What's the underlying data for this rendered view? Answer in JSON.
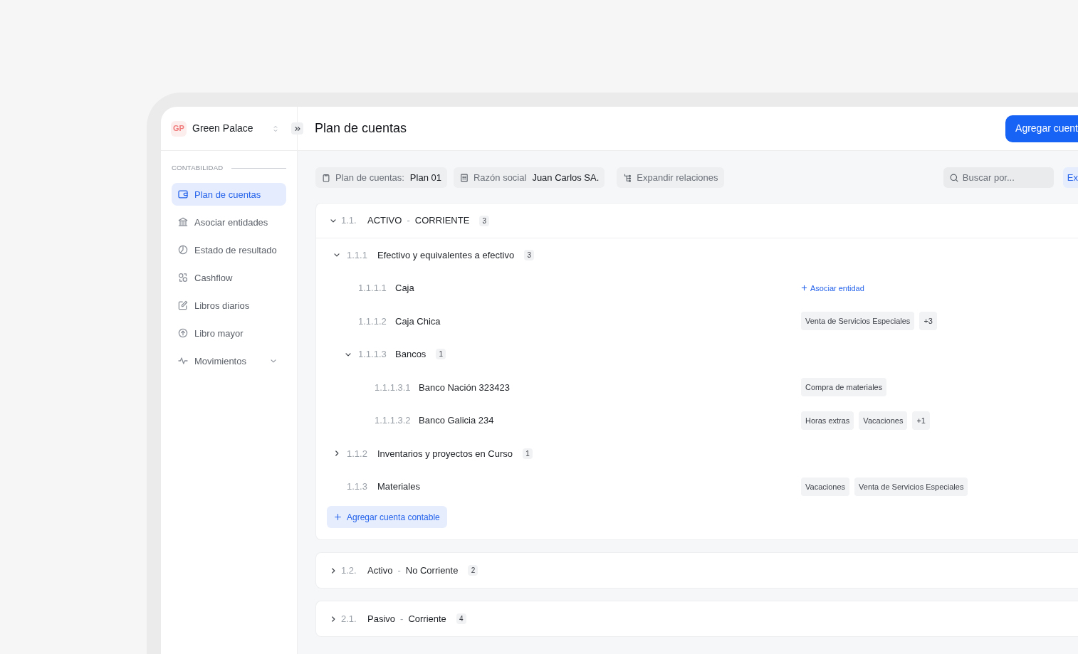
{
  "workspace": {
    "initials": "GP",
    "name": "Green Palace"
  },
  "sidebar": {
    "section_label": "CONTABILIDAD",
    "items": [
      {
        "label": "Plan de cuentas",
        "selected": true
      },
      {
        "label": "Asociar entidades",
        "selected": false
      },
      {
        "label": "Estado de resultado",
        "selected": false
      },
      {
        "label": "Cashflow",
        "selected": false
      },
      {
        "label": "Libros diarios",
        "selected": false
      },
      {
        "label": "Libro mayor",
        "selected": false
      },
      {
        "label": "Movimientos",
        "selected": false,
        "expanded": false
      }
    ]
  },
  "header": {
    "title": "Plan de cuentas",
    "primary_button": "Agregar cuent"
  },
  "toolbar": {
    "chips": [
      {
        "kind": "filter",
        "label": "Plan de cuentas:",
        "value": "Plan 01"
      },
      {
        "kind": "filter",
        "label": "Razón social",
        "value": "Juan Carlos SA."
      },
      {
        "kind": "action",
        "label": "Expandir relaciones"
      }
    ],
    "search": {
      "placeholder": "Buscar por..."
    },
    "export_button": "Ex"
  },
  "sections": [
    {
      "code": "1.1.",
      "name": "ACTIVO",
      "separator": "-",
      "subname": "CORRIENTE",
      "count": "3",
      "expanded": true,
      "add_button": "Agregar cuenta contable",
      "accounts": [
        {
          "code": "1.1.1",
          "name": "Efectivo y equivalentes a efectivo",
          "count": "3",
          "expanded": true,
          "children": [
            {
              "code": "1.1.1.1",
              "name": "Caja",
              "link": "Asociar entidad"
            },
            {
              "code": "1.1.1.2",
              "name": "Caja Chica",
              "tags": [
                "Venta de Servicios Especiales",
                "+3"
              ]
            },
            {
              "code": "1.1.1.3",
              "name": "Bancos",
              "count": "1",
              "expanded": true,
              "children": [
                {
                  "code": "1.1.1.3.1",
                  "name": "Banco Nación 323423",
                  "tags": [
                    "Compra de materiales"
                  ]
                },
                {
                  "code": "1.1.1.3.2",
                  "name": "Banco Galicia 234",
                  "tags": [
                    "Horas extras",
                    "Vacaciones",
                    "+1"
                  ]
                }
              ]
            }
          ]
        },
        {
          "code": "1.1.2",
          "name": "Inventarios y proyectos en Curso",
          "count": "1",
          "expanded": false
        },
        {
          "code": "1.1.3",
          "name": "Materiales",
          "tags": [
            "Vacaciones",
            "Venta de Servicios Especiales"
          ]
        }
      ]
    },
    {
      "code": "1.2.",
      "name": "Activo",
      "separator": "-",
      "subname": "No Corriente",
      "count": "2",
      "expanded": false
    },
    {
      "code": "2.1.",
      "name": "Pasivo",
      "separator": "-",
      "subname": "Corriente",
      "count": "4",
      "expanded": false
    }
  ]
}
